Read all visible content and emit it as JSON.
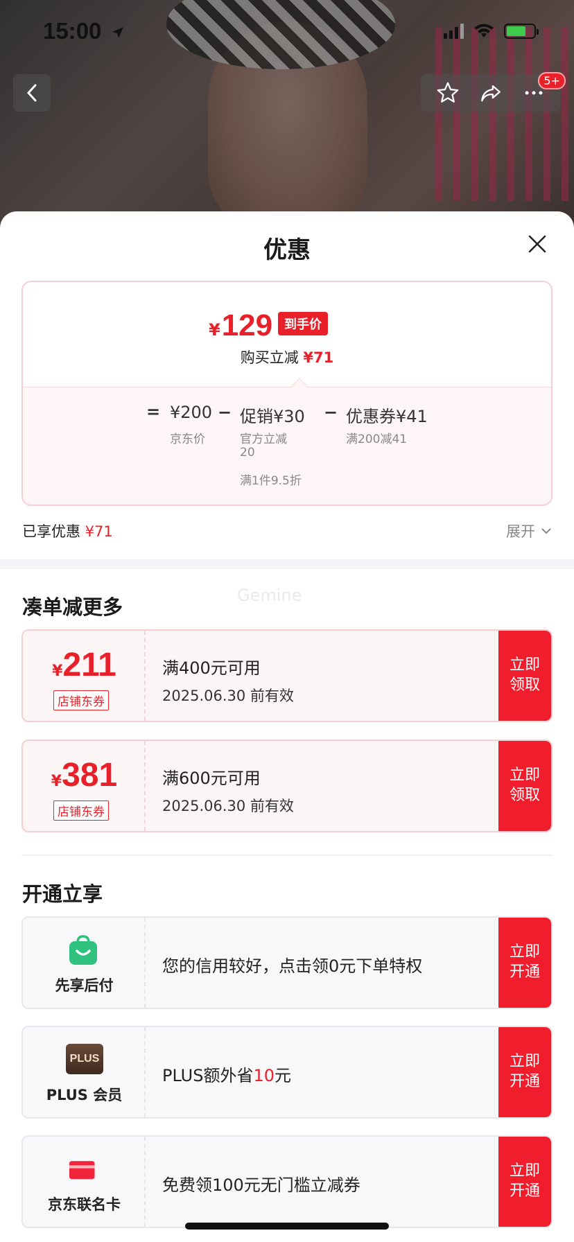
{
  "status_bar": {
    "time": "15:00"
  },
  "nav": {
    "badge": "5+"
  },
  "sheet": {
    "title": "优惠"
  },
  "price": {
    "final_yen": "¥",
    "final_value": "129",
    "final_tag": "到手价",
    "buy_reduce_label": "购买立减",
    "buy_reduce_value": "¥71",
    "eq": "=",
    "jd_price": "¥200",
    "jd_price_label": "京东价",
    "minus1": "−",
    "promo": "促销¥30",
    "promo_sub1": "官方立减",
    "promo_sub2": "20",
    "promo_sub3": "满1件9.5折",
    "minus2": "−",
    "coupon": "优惠券¥41",
    "coupon_sub": "满200减41"
  },
  "enjoyed": {
    "label": "已享优惠",
    "value": "¥71",
    "expand": "展开"
  },
  "more_section": {
    "title": "凑单减更多",
    "watermark": "Gemine"
  },
  "coupons": [
    {
      "yen": "¥",
      "amount": "211",
      "type": "店铺东券",
      "condition": "满400元可用",
      "valid": "2025.06.30 前有效",
      "button": "立即\n领取"
    },
    {
      "yen": "¥",
      "amount": "381",
      "type": "店铺东券",
      "condition": "满600元可用",
      "valid": "2025.06.30 前有效",
      "button": "立即\n领取"
    }
  ],
  "open_section": {
    "title": "开通立享"
  },
  "services": [
    {
      "name": "先享后付",
      "icon": "shopping-bag-icon",
      "desc": "您的信用较好，点击领0元下单特权",
      "button": "立即\n开通"
    },
    {
      "name": "PLUS 会员",
      "icon": "plus-icon",
      "icon_text": "PLUS",
      "desc_pre": "PLUS额外省",
      "desc_red": "10",
      "desc_post": "元",
      "button": "立即\n开通"
    },
    {
      "name": "京东联名卡",
      "icon": "credit-card-icon",
      "desc": "免费领100元无门槛立减券",
      "button": "立即\n开通"
    }
  ],
  "colors": {
    "accent": "#e8202a",
    "button": "#f01e2c",
    "green": "#2ec27e",
    "plus": "#5a3f30"
  }
}
